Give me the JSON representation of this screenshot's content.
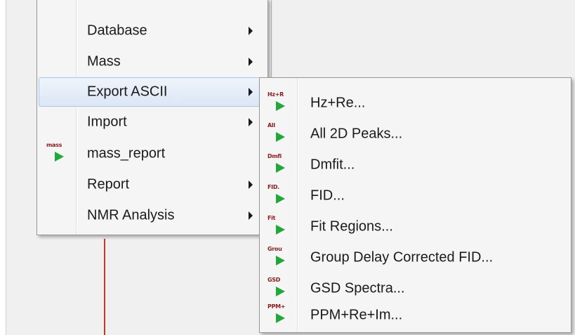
{
  "main_menu": {
    "items": [
      {
        "label": "Database",
        "has_submenu": true
      },
      {
        "label": "Mass",
        "has_submenu": true
      },
      {
        "label": "Export ASCII",
        "has_submenu": true,
        "highlighted": true
      },
      {
        "label": "Import",
        "has_submenu": true
      },
      {
        "label": "mass_report",
        "has_submenu": false,
        "icon_tag": "mass",
        "icon": "green-play-icon"
      },
      {
        "label": "Report",
        "has_submenu": true
      },
      {
        "label": "NMR Analysis",
        "has_submenu": true
      }
    ]
  },
  "export_ascii_submenu": {
    "items": [
      {
        "label": "Hz+Re...",
        "icon_tag": "Hz+R",
        "icon": "green-play-icon"
      },
      {
        "label": "All 2D Peaks...",
        "icon_tag": "All",
        "icon": "green-play-icon"
      },
      {
        "label": "Dmfit...",
        "icon_tag": "Dmfi",
        "icon": "green-play-icon"
      },
      {
        "label": "FID...",
        "icon_tag": "FID.",
        "icon": "green-play-icon"
      },
      {
        "label": "Fit Regions...",
        "icon_tag": "Fit",
        "icon": "green-play-icon"
      },
      {
        "label": "Group Delay Corrected FID...",
        "icon_tag": "Grou",
        "icon": "green-play-icon"
      },
      {
        "label": "GSD Spectra...",
        "icon_tag": "GSD",
        "icon": "green-play-icon"
      },
      {
        "label": "PPM+Re+Im...",
        "icon_tag": "PPM+",
        "icon": "green-play-icon"
      }
    ]
  },
  "colors": {
    "menu_background": "#f5f5f5",
    "highlight": "#dbe7f5",
    "highlight_border": "#a8c7ea",
    "play_icon": "#22a838",
    "icon_tag": "#8b1a1a",
    "marker_line": "#c0392b"
  }
}
